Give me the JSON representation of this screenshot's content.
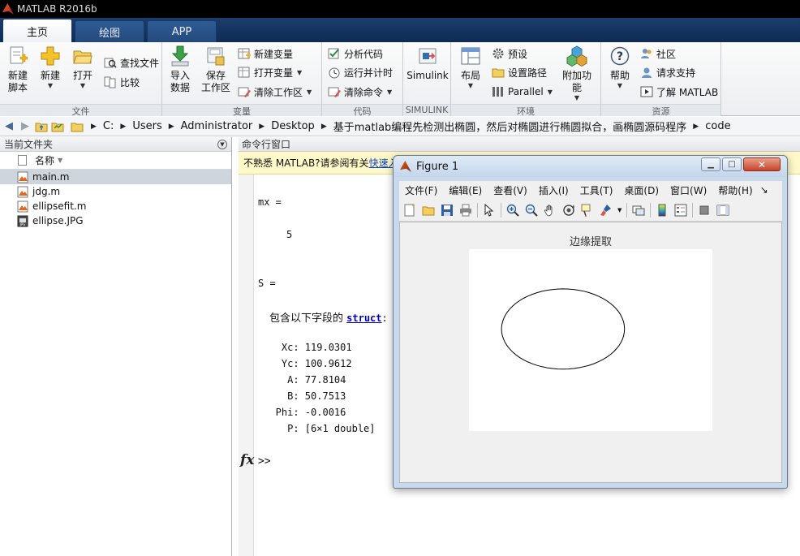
{
  "window": {
    "title": "MATLAB R2016b"
  },
  "tabs": [
    {
      "label": "主页",
      "active": true
    },
    {
      "label": "绘图",
      "active": false
    },
    {
      "label": "APP",
      "active": false
    }
  ],
  "ribbon": {
    "file": {
      "label": "文件",
      "new_script": [
        "新建",
        "脚本"
      ],
      "new": "新建",
      "open": "打开",
      "find_files": "查找文件",
      "compare": "比较"
    },
    "variable": {
      "label": "变量",
      "import": [
        "导入",
        "数据"
      ],
      "save": [
        "保存",
        "工作区"
      ],
      "new_var": "新建变量",
      "open_var": "打开变量",
      "clear_ws": "清除工作区"
    },
    "code": {
      "label": "代码",
      "analyze": "分析代码",
      "run_time": "运行并计时",
      "clear_cmd": "清除命令"
    },
    "simulink": {
      "label": "SIMULINK",
      "btn": "Simulink"
    },
    "env": {
      "label": "环境",
      "layout": "布局",
      "prefs": "预设",
      "set_path": "设置路径",
      "parallel": "Parallel",
      "addons": "附加功能"
    },
    "resources": {
      "label": "资源",
      "help": "帮助",
      "community": "社区",
      "support": "请求支持",
      "learn": "了解 MATLAB"
    }
  },
  "address": {
    "crumbs": [
      "C:",
      "Users",
      "Administrator",
      "Desktop",
      "基于matlab编程先检测出椭圆，然后对椭圆进行椭圆拟合，画椭圆源码程序",
      "code"
    ]
  },
  "current_folder": {
    "title": "当前文件夹",
    "col_name": "名称",
    "files": [
      {
        "name": "main.m",
        "icon": "m-file-icon",
        "selected": true
      },
      {
        "name": "jdg.m",
        "icon": "m-file-icon",
        "selected": false
      },
      {
        "name": "ellipsefit.m",
        "icon": "m-file-icon",
        "selected": false
      },
      {
        "name": "ellipse.JPG",
        "icon": "image-file-icon",
        "selected": false
      }
    ]
  },
  "command_window": {
    "title": "命令行窗口",
    "info_text": "不熟悉 MATLAB?请参阅有关",
    "info_link": "快速入门",
    "mx_line": "mx =",
    "mx_value": "5",
    "s_line": "S =",
    "struct_prefix": "包含以下字段的 ",
    "struct_link": "struct",
    "struct_colon": ":",
    "fields": [
      "    Xc: 119.0301",
      "    Yc: 100.9612",
      "     A: 77.8104",
      "     B: 50.7513",
      "   Phi: -0.0016",
      "     P: [6×1 double]"
    ],
    "prompt": ">>",
    "fx": "fx"
  },
  "figure": {
    "title": "Figure 1",
    "menus": [
      "文件(F)",
      "编辑(E)",
      "查看(V)",
      "插入(I)",
      "工具(T)",
      "桌面(D)",
      "窗口(W)",
      "帮助(H)"
    ],
    "more": "↘",
    "axes_title": "边缘提取",
    "ellipse": {
      "xc": 119.0301,
      "yc": 100.9612,
      "a": 77.8104,
      "b": 50.7513,
      "phi": -0.0016
    }
  }
}
